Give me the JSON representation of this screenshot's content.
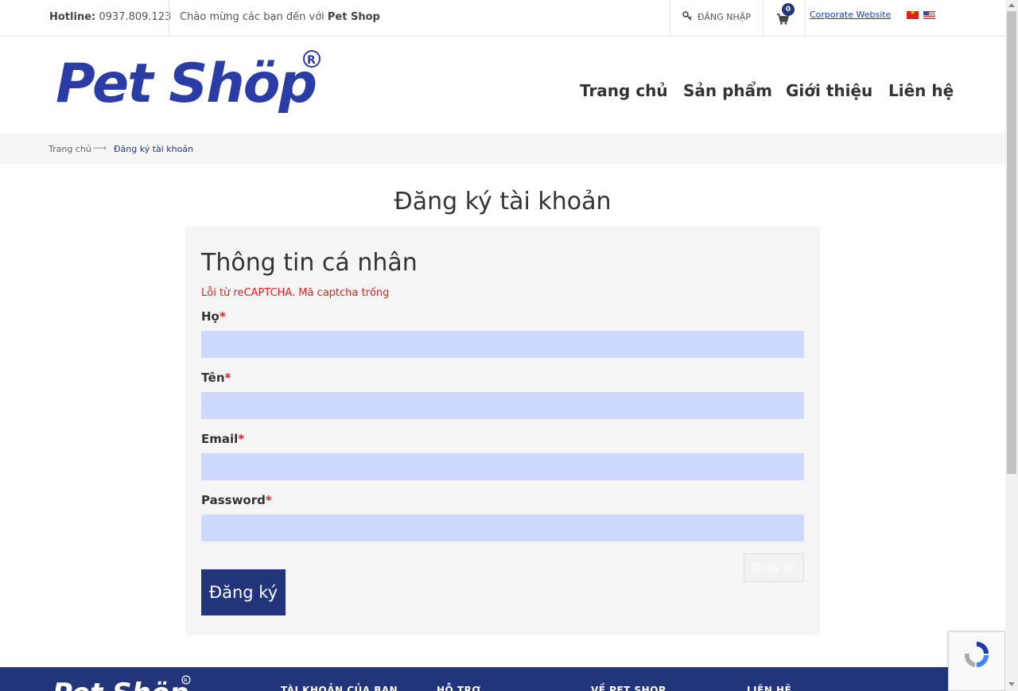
{
  "topbar": {
    "hotline_label": "Hotline:",
    "hotline_number": "0937.809.123",
    "welcome_text": "Chào mừng các bạn đến với",
    "welcome_brand": "Pet Shop",
    "login_label": "ĐĂNG NHẬP",
    "cart_count": "0",
    "corporate_link": "Corporate Website",
    "languages": [
      "vi",
      "en"
    ]
  },
  "header": {
    "logo_text": "Pet Shöp",
    "nav": [
      "Trang chủ",
      "Sản phẩm",
      "Giới thiệu",
      "Liên hệ"
    ]
  },
  "breadcrumb": {
    "home": "Trang chủ",
    "separator": "⟶",
    "current": "Đăng ký tài khoản"
  },
  "page": {
    "title": "Đăng ký tài khoản"
  },
  "form": {
    "section_title": "Thông tin cá nhân",
    "error": "Lỗi từ reCAPTCHA. Mã captcha trống",
    "required_mark": "*",
    "fields": [
      {
        "label": "Họ",
        "value": ""
      },
      {
        "label": "Tên",
        "value": ""
      },
      {
        "label": "Email",
        "value": ""
      },
      {
        "label": "Password",
        "value": ""
      }
    ],
    "back_button": "Quay lại",
    "submit_button": "Đăng ký"
  },
  "footer": {
    "columns": [
      "TÀI KHOẢN CỦA BẠN",
      "HỖ TRỢ",
      "VỀ PET SHOP",
      "LIÊN HỆ"
    ]
  },
  "colors": {
    "brand": "#22347a",
    "error": "#e02020",
    "input_bg": "#cfd8fd"
  }
}
